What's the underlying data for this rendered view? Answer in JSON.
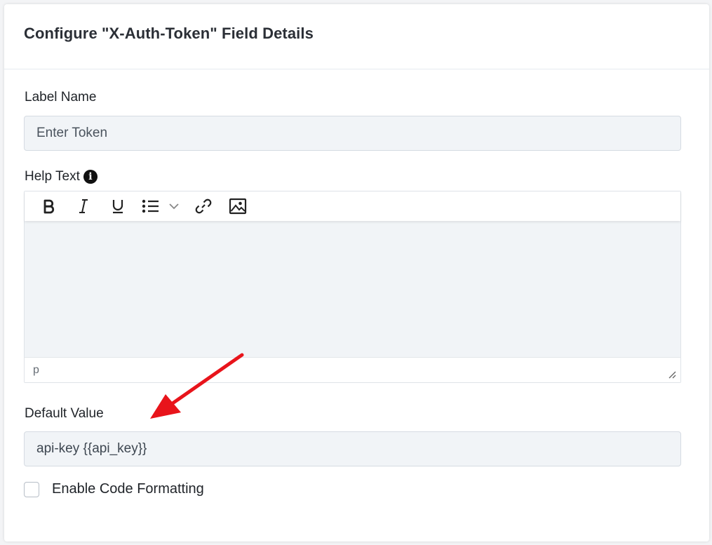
{
  "modal": {
    "title": "Configure \"X-Auth-Token\" Field Details"
  },
  "label_name": {
    "label": "Label Name",
    "value": "",
    "placeholder": "Enter Token"
  },
  "help_text": {
    "label": "Help Text",
    "info_icon": "info-circle-icon",
    "toolbar": [
      "bold-icon",
      "italic-icon",
      "underline-icon",
      "bullet-list-icon",
      "chevron-down-icon",
      "link-icon",
      "image-icon"
    ],
    "content": "",
    "status_path": "p"
  },
  "default_value": {
    "label": "Default Value",
    "value": "api-key {{api_key}}"
  },
  "code_formatting": {
    "label": "Enable Code Formatting",
    "checked": false
  },
  "colors": {
    "annotation_arrow": "#e8141b",
    "input_bg": "#f1f4f7",
    "input_border": "#d5dbe2"
  }
}
